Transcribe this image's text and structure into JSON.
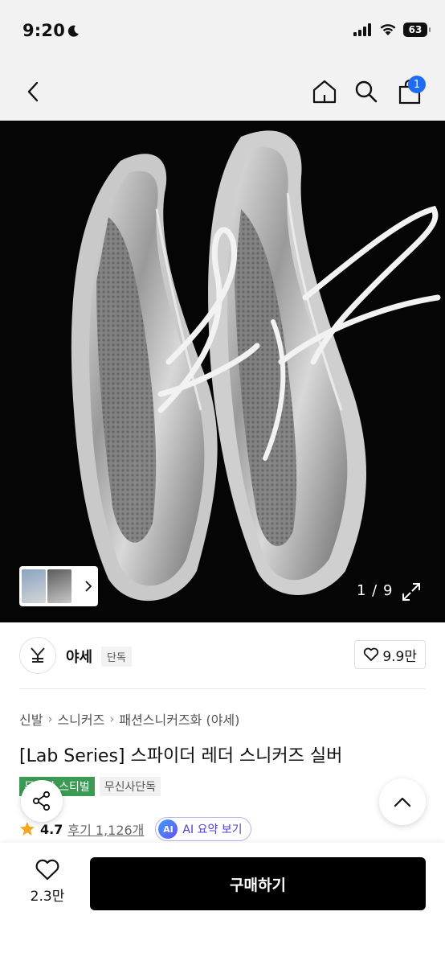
{
  "status_bar": {
    "time": "9:20",
    "battery": "63"
  },
  "header": {
    "cart_count": "1"
  },
  "gallery": {
    "counter": "1 / 9"
  },
  "brand": {
    "logo_text": "YAS",
    "name": "야세",
    "tag": "단독",
    "like_count": "9.9만"
  },
  "breadcrumb": {
    "items": [
      "신발",
      "스니커즈",
      "패션스니커즈화 (야세)"
    ]
  },
  "product": {
    "title": "[Lab Series] 스파이더 레더 스니커즈 실버"
  },
  "tags": {
    "green": "무진장 스티벌",
    "gray": "무신사단독"
  },
  "rating": {
    "score": "4.7",
    "reviews": "후기 1,126개",
    "ai_label": "AI",
    "ai_text": "AI 요약 보기"
  },
  "bottom_bar": {
    "wish_count": "2.3만",
    "buy_label": "구매하기"
  },
  "colors": {
    "accent_blue": "#1d6cf2",
    "buy_black": "#000000",
    "tag_green": "#3b9a53",
    "ai_purple": "#4c3fd6",
    "star": "#f5a623"
  }
}
